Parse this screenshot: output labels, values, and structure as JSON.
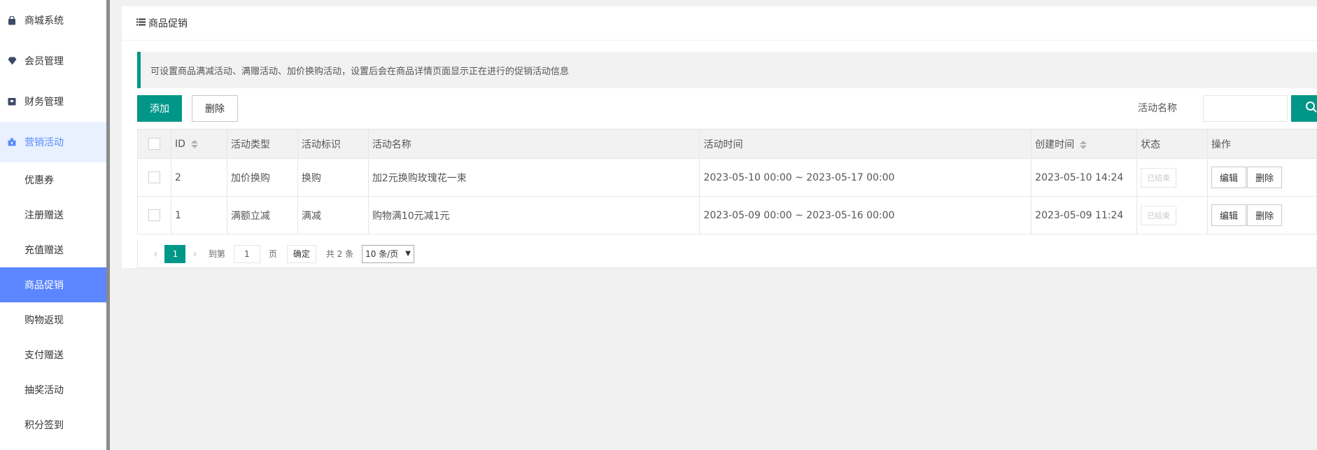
{
  "sidebar": {
    "items": [
      {
        "label": "商城系统",
        "icon": "shop-bag-icon"
      },
      {
        "label": "会员管理",
        "icon": "diamond-icon"
      },
      {
        "label": "财务管理",
        "icon": "wallet-icon"
      },
      {
        "label": "营销活动",
        "icon": "gift-icon"
      }
    ],
    "sub_items": [
      "优惠券",
      "注册赠送",
      "充值赠送",
      "商品促销",
      "购物返现",
      "支付赠送",
      "抽奖活动",
      "积分签到"
    ],
    "active_sub": "商品促销"
  },
  "panel": {
    "title": "商品促销",
    "notice": "可设置商品满减活动、满赠活动、加价换购活动，设置后会在商品详情页面显示正在进行的促销活动信息"
  },
  "toolbar": {
    "add_label": "添加",
    "delete_label": "删除",
    "search_label": "活动名称",
    "search_value": ""
  },
  "table": {
    "headers": [
      "ID",
      "活动类型",
      "活动标识",
      "活动名称",
      "活动时间",
      "创建时间",
      "状态",
      "操作"
    ],
    "rows": [
      {
        "id": "2",
        "type": "加价换购",
        "tag": "换购",
        "name": "加2元换购玫瑰花一束",
        "time": "2023-05-10 00:00 ~ 2023-05-17 00:00",
        "created": "2023-05-10 14:24",
        "status": "已结束",
        "edit": "编辑",
        "delete": "删除"
      },
      {
        "id": "1",
        "type": "满额立减",
        "tag": "满减",
        "name": "购物满10元减1元",
        "time": "2023-05-09 00:00 ~ 2023-05-16 00:00",
        "created": "2023-05-09 11:24",
        "status": "已结束",
        "edit": "编辑",
        "delete": "删除"
      }
    ]
  },
  "pager": {
    "current": "1",
    "goto_label": "到第",
    "goto_value": "1",
    "page_unit": "页",
    "confirm": "确定",
    "total": "共 2 条",
    "per_page": "10 条/页"
  },
  "colors": {
    "primary": "#009688",
    "sidebar_active": "#5b86ff"
  }
}
